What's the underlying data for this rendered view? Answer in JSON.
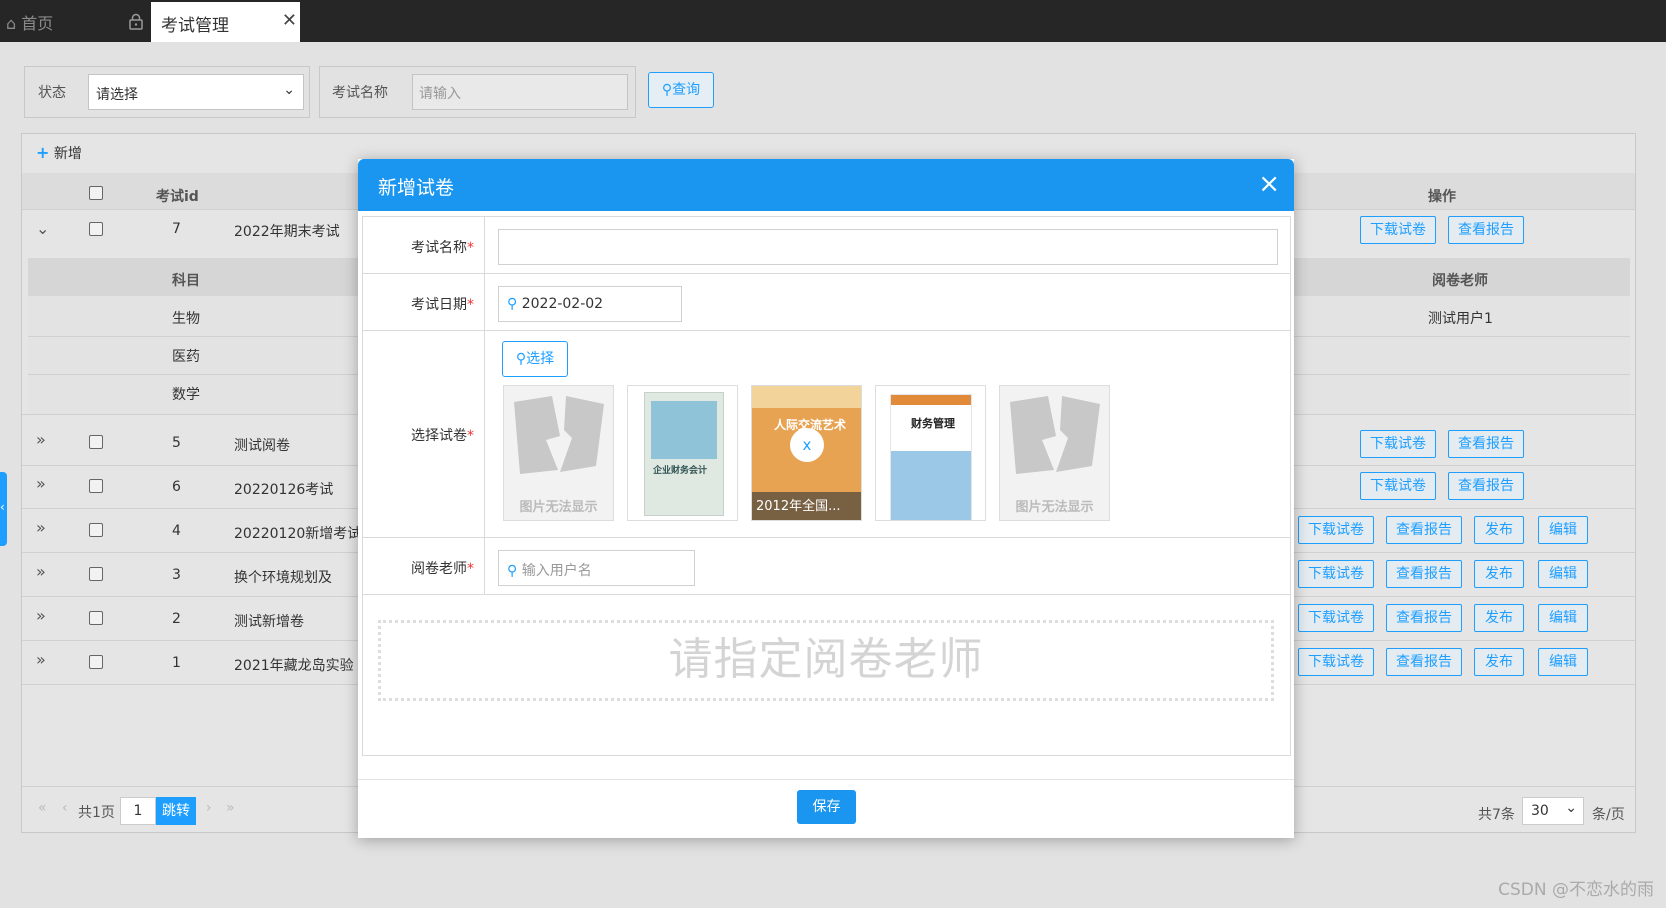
{
  "tabs": {
    "home": "首页",
    "current": "考试管理"
  },
  "filter": {
    "status_label": "状态",
    "status_value": "请选择",
    "name_label": "考试名称",
    "name_placeholder": "请输入",
    "query_label": "查询"
  },
  "toolbar": {
    "add_label": "新增"
  },
  "table": {
    "col_id": "考试id",
    "col_ops": "操作",
    "rows": [
      {
        "id": "7",
        "name": "2022年期末考试"
      },
      {
        "id": "5",
        "name": "测试阅卷"
      },
      {
        "id": "6",
        "name": "20220126考试"
      },
      {
        "id": "4",
        "name": "20220120新增考试"
      },
      {
        "id": "3",
        "name": "换个环境规划及"
      },
      {
        "id": "2",
        "name": "测试新增卷"
      },
      {
        "id": "1",
        "name": "2021年藏龙岛实验"
      }
    ],
    "sub": {
      "col_subject": "科目",
      "col_teacher": "阅卷老师",
      "subjects": [
        "生物",
        "医药",
        "数学"
      ],
      "teacher": "测试用户1"
    },
    "ops": {
      "download": "下载试卷",
      "report": "查看报告",
      "publish": "发布",
      "edit": "编辑"
    }
  },
  "pager": {
    "total_pages": "共1页",
    "page": "1",
    "jump": "跳转",
    "total": "共7条",
    "page_size": "30",
    "per_page": "条/页"
  },
  "modal": {
    "title": "新增试卷",
    "name_label": "考试名称",
    "date_label": "考试日期",
    "date_value": "2022-02-02",
    "paper_label": "选择试卷",
    "select_label": "选择",
    "thumbs": {
      "broken": "图片无法显示",
      "selected_caption": "2012年全国...",
      "remove": "x",
      "cover2_title": "企业财务会计",
      "cover3_title": "人际交流艺术",
      "cover4_title": "财务管理"
    },
    "teacher_label": "阅卷老师",
    "teacher_placeholder": "输入用户名",
    "hint": "请指定阅卷老师",
    "save_label": "保存"
  },
  "watermark": "CSDN @不恋水的雨",
  "colors": {
    "accent": "#1e9fff",
    "header": "#1a96f0",
    "topbar": "#262626"
  }
}
